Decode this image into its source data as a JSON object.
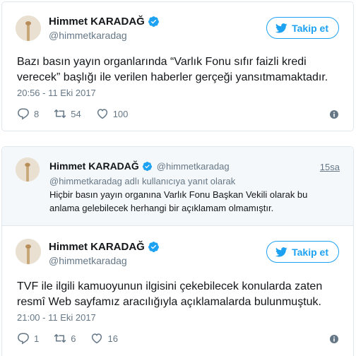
{
  "colors": {
    "accent": "#1da1f2",
    "muted": "#657786",
    "verified": "#1da1f2",
    "border": "#e1e8ed",
    "reply_bg": "#f5f8fa"
  },
  "tweet1": {
    "author_name": "Himmet KARADAĞ",
    "handle": "@himmetkaradag",
    "follow_label": "Takip et",
    "text": "Bazı basın yayın organlarında “Varlık Fonu sıfır faizli kredi verecek” başlığı ile verilen haberler gerçeği yansıtmamaktadır.",
    "timestamp": "20:56 - 11 Eki 2017",
    "replies": "8",
    "retweets": "54",
    "likes": "100"
  },
  "tweet2": {
    "reply_context": {
      "author_name": "Himmet KARADAĞ",
      "handle": "@himmetkaradag",
      "time": "15sa",
      "reply_to": "@himmetkaradag adlı kullanıcıya yanıt olarak",
      "text": "Hiçbir basın yayın organına Varlık Fonu Başkan Vekili olarak bu anlama gelebilecek herhangi bir açıklamam olmamıştır."
    },
    "author_name": "Himmet KARADAĞ",
    "handle": "@himmetkaradag",
    "follow_label": "Takip et",
    "text": "TVF ile ilgili kamuoyunun ilgisini çekebilecek konularda zaten resmî Web sayfamız aracılığıyla açıklamalarda bulunmuştuk.",
    "timestamp": "21:00 - 11 Eki 2017",
    "replies": "1",
    "retweets": "6",
    "likes": "16"
  },
  "icons": [
    "avatar",
    "verified-badge-icon",
    "twitter-bird-icon",
    "reply-icon",
    "retweet-icon",
    "like-heart-icon",
    "info-icon"
  ]
}
